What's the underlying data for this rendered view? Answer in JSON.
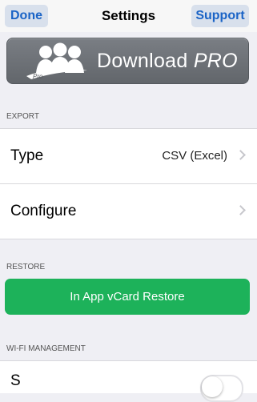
{
  "navbar": {
    "title": "Settings",
    "left_button": "Done",
    "right_button": "Support"
  },
  "pro_banner": {
    "label_main": "Download ",
    "label_pro": "PRO",
    "icon_text": "Pro",
    "icon": "people-group-icon"
  },
  "export": {
    "header": "EXPORT",
    "rows": [
      {
        "label": "Type",
        "value": "CSV (Excel)"
      },
      {
        "label": "Configure",
        "value": ""
      }
    ]
  },
  "restore": {
    "header": "RESTORE",
    "button_label": "In App vCard Restore"
  },
  "wifi": {
    "header": "WI-FI MANAGEMENT",
    "row_label": "S",
    "toggle_on": false
  },
  "colors": {
    "nav_button_text": "#1a63c6",
    "restore_button": "#1db25a",
    "pro_banner": "#6c7075",
    "background": "#efeff4"
  }
}
